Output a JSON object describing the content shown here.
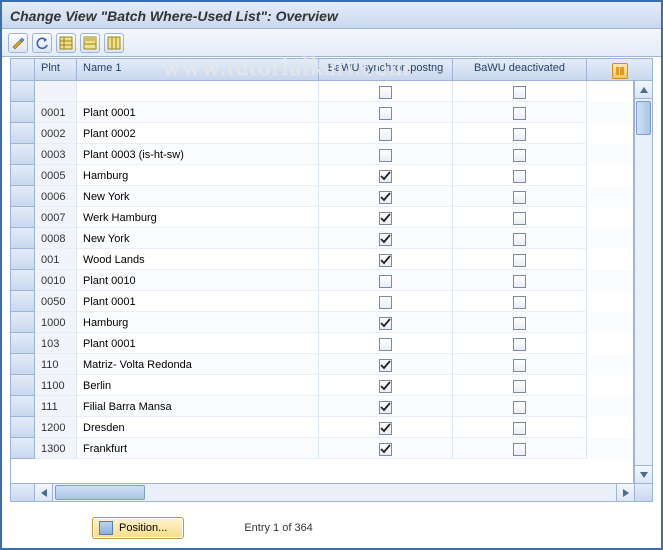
{
  "watermark": "www.tutorialkart.com",
  "title": "Change View \"Batch Where-Used List\": Overview",
  "toolbar": {
    "t1_tip": "Undo",
    "t2_tip": "Redo",
    "t3_tip": "Other view",
    "t4_tip": "Save",
    "t5_tip": "Table settings"
  },
  "columns": {
    "plnt": "Plnt",
    "name": "Name 1",
    "sync": "BaWU synchron.postng",
    "deact": "BaWU deactivated"
  },
  "rows": [
    {
      "plnt": "",
      "name": "",
      "sync": false,
      "deact": false
    },
    {
      "plnt": "0001",
      "name": "Plant 0001",
      "sync": false,
      "deact": false
    },
    {
      "plnt": "0002",
      "name": "Plant 0002",
      "sync": false,
      "deact": false
    },
    {
      "plnt": "0003",
      "name": "Plant 0003 (is-ht-sw)",
      "sync": false,
      "deact": false
    },
    {
      "plnt": "0005",
      "name": "Hamburg",
      "sync": true,
      "deact": false
    },
    {
      "plnt": "0006",
      "name": "New York",
      "sync": true,
      "deact": false
    },
    {
      "plnt": "0007",
      "name": "Werk Hamburg",
      "sync": true,
      "deact": false
    },
    {
      "plnt": "0008",
      "name": "New York",
      "sync": true,
      "deact": false
    },
    {
      "plnt": "001",
      "name": "Wood Lands",
      "sync": true,
      "deact": false
    },
    {
      "plnt": "0010",
      "name": "Plant 0010",
      "sync": false,
      "deact": false
    },
    {
      "plnt": "0050",
      "name": "Plant 0001",
      "sync": false,
      "deact": false
    },
    {
      "plnt": "1000",
      "name": "Hamburg",
      "sync": true,
      "deact": false
    },
    {
      "plnt": "103",
      "name": "Plant 0001",
      "sync": false,
      "deact": false
    },
    {
      "plnt": "110",
      "name": "Matriz- Volta Redonda",
      "sync": true,
      "deact": false
    },
    {
      "plnt": "1100",
      "name": "Berlin",
      "sync": true,
      "deact": false
    },
    {
      "plnt": "111",
      "name": "Filial Barra Mansa",
      "sync": true,
      "deact": false
    },
    {
      "plnt": "1200",
      "name": "Dresden",
      "sync": true,
      "deact": false
    },
    {
      "plnt": "1300",
      "name": "Frankfurt",
      "sync": true,
      "deact": false
    }
  ],
  "footer": {
    "position_label": "Position...",
    "entry_text": "Entry 1 of 364"
  }
}
